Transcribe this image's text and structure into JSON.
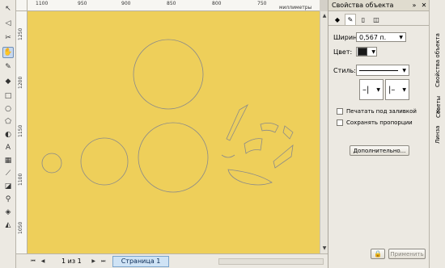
{
  "rulers": {
    "unit": "миллиметры",
    "top_ticks": [
      "1100",
      "950",
      "900",
      "850",
      "800",
      "750"
    ],
    "left_ticks": [
      "1250",
      "1200",
      "1150",
      "1100",
      "1050"
    ]
  },
  "toolbox": {
    "tools": [
      "pick-tool-icon",
      "shape-tool-icon",
      "crop-tool-icon",
      "zoom-tool-icon",
      "freehand-tool-icon",
      "smart-fill-icon",
      "rectangle-tool-icon",
      "ellipse-tool-icon",
      "polygon-tool-icon",
      "basic-shapes-icon",
      "text-tool-icon",
      "table-tool-icon",
      "dimension-tool-icon",
      "connector-tool-icon",
      "blend-tool-icon",
      "eyedropper-icon",
      "outline-tool-icon",
      "fill-tool-icon",
      "interactive-fill-icon"
    ]
  },
  "statusbar": {
    "page_counter": "1 из 1",
    "page_tab": "Страница 1"
  },
  "docker": {
    "title": "Свойства объекта",
    "width_label": "Ширина:",
    "width_value": "0,567 п.",
    "color_label": "Цвет:",
    "style_label": "Стиль:",
    "print_behind_fill": "Печатать под заливкой",
    "keep_proportions": "Сохранять пропорции",
    "advanced_button": "Дополнительно...",
    "apply_button": "Применить"
  },
  "side_tabs": {
    "properties": "Свойства объекта",
    "hints": "Советы",
    "lens": "Линза"
  },
  "colors": {
    "canvas": "#eecf5a",
    "outline": "#8a8a8a"
  }
}
